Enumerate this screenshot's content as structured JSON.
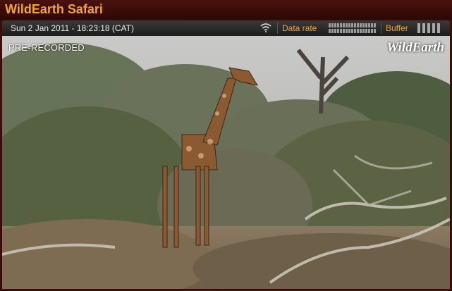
{
  "window": {
    "title": "WildEarth Safari"
  },
  "status": {
    "datetime": "Sun 2 Jan 2011 - 18:23:18 (CAT)",
    "data_rate_label": "Data rate",
    "buffer_label": "Buffer",
    "signal_icon": "wifi-signal-icon"
  },
  "video": {
    "overlay_label": "PRE-RECORDED",
    "logo_text": "WildEarth",
    "scene": "giraffe-in-bushveld"
  },
  "colors": {
    "accent": "#f2a623",
    "titlebar": "#3a0e0b",
    "statusbar": "#2a2a2a"
  }
}
